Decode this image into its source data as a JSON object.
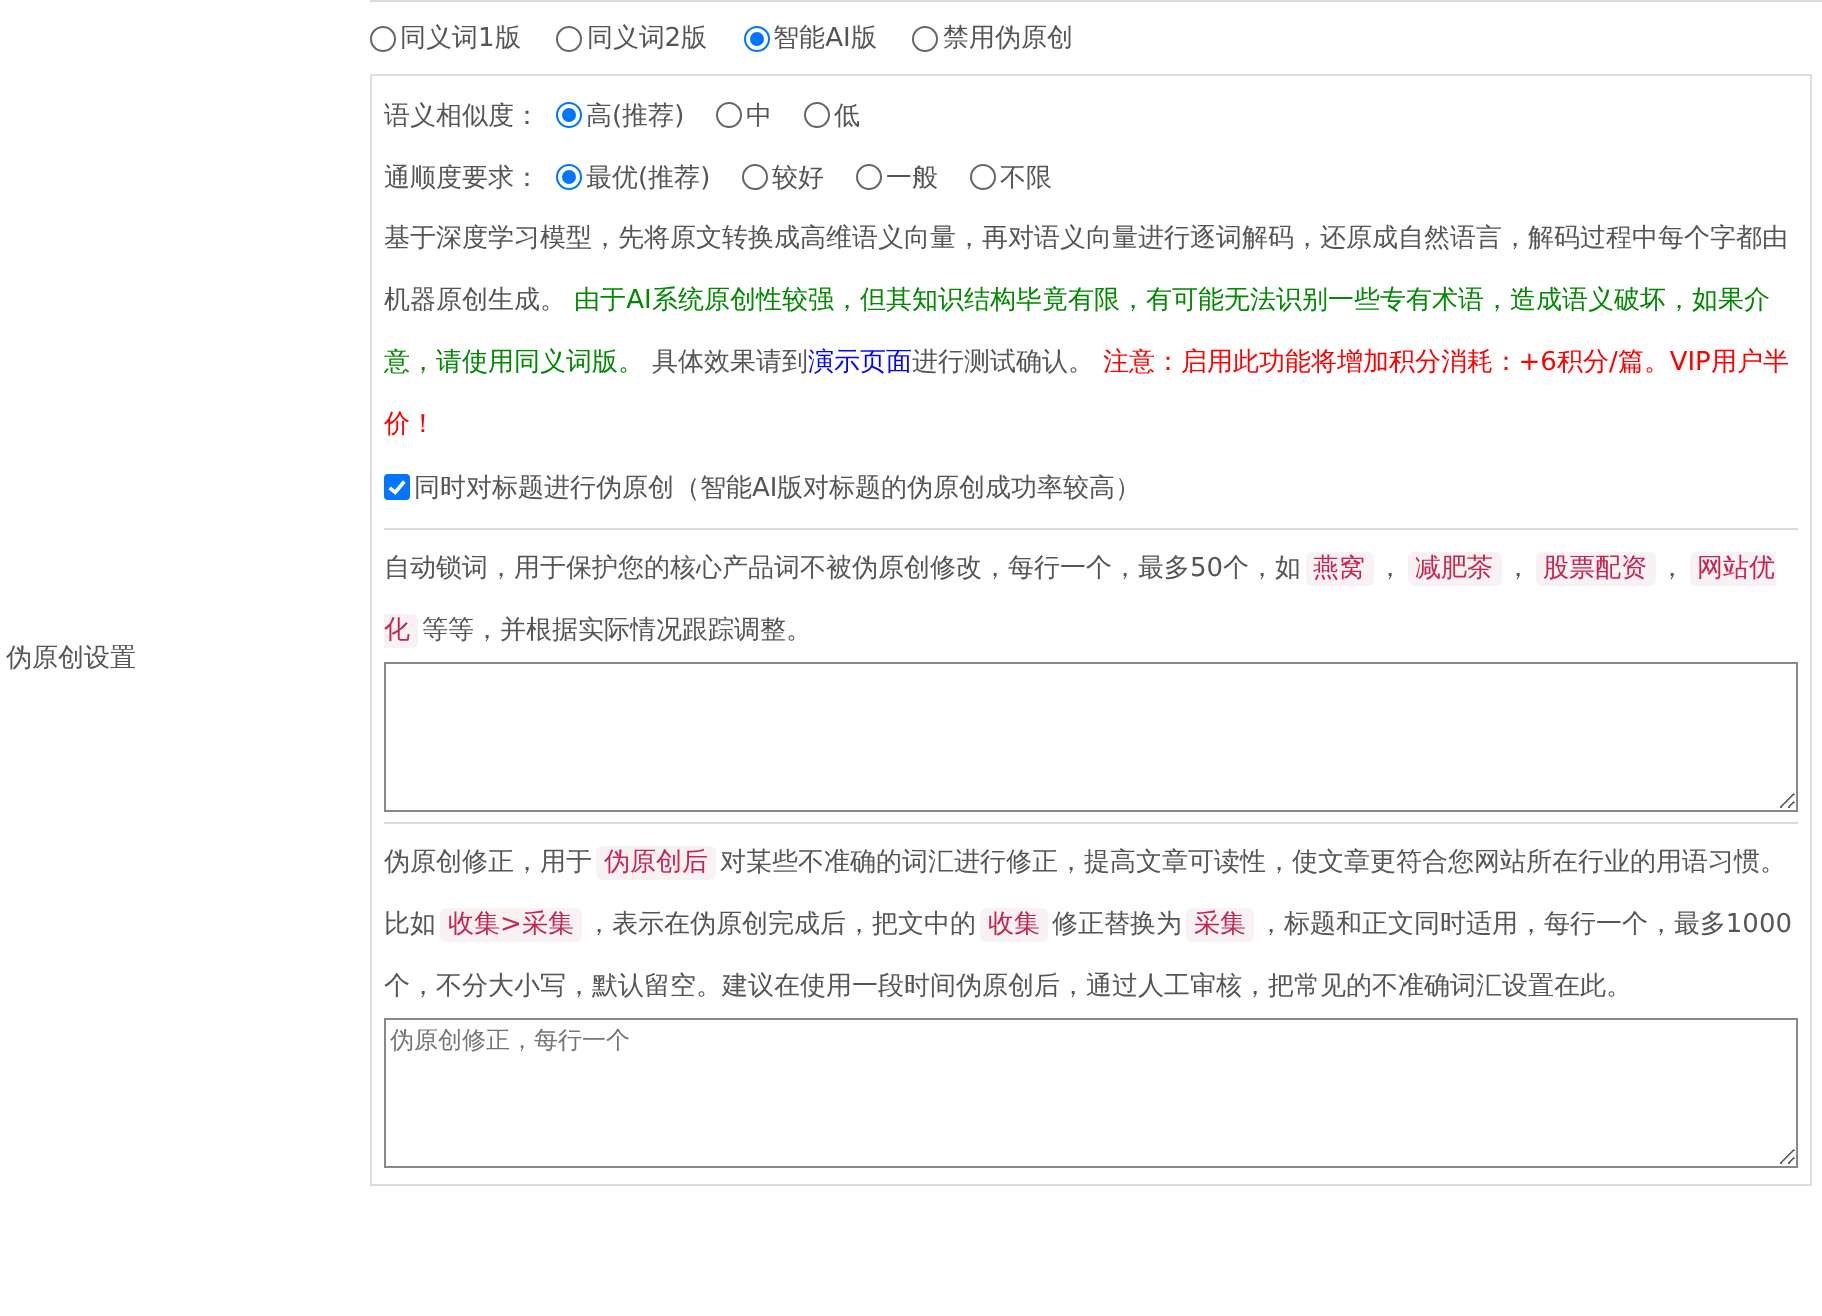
{
  "section_label": "伪原创设置",
  "modes": [
    {
      "label": "同义词1版",
      "selected": false
    },
    {
      "label": "同义词2版",
      "selected": false
    },
    {
      "label": "智能AI版",
      "selected": true
    },
    {
      "label": "禁用伪原创",
      "selected": false
    }
  ],
  "similarity": {
    "label": "语义相似度：",
    "options": [
      {
        "label": "高(推荐)",
        "selected": true
      },
      {
        "label": "中",
        "selected": false
      },
      {
        "label": "低",
        "selected": false
      }
    ]
  },
  "fluency": {
    "label": "通顺度要求：",
    "options": [
      {
        "label": "最优(推荐)",
        "selected": true
      },
      {
        "label": "较好",
        "selected": false
      },
      {
        "label": "一般",
        "selected": false
      },
      {
        "label": "不限",
        "selected": false
      }
    ]
  },
  "description": [
    {
      "kind": "plain",
      "text": "基于深度学习模型，先将原文转换成高维语义向量，再对语义向量进行逐词解码，还原成自然语言，解码过程中每个字都由机器原创生成。 "
    },
    {
      "kind": "green",
      "text": "由于AI系统原创性较强，但其知识结构毕竟有限，有可能无法识别一些专有术语，造成语义破坏，如果介意，请使用同义词版。"
    },
    {
      "kind": "plain",
      "text": " 具体效果请到"
    },
    {
      "kind": "link",
      "text": "演示页面"
    },
    {
      "kind": "plain",
      "text": "进行测试确认。 "
    },
    {
      "kind": "red",
      "text": "注意：启用此功能将增加积分消耗：+6积分/篇。VIP用户半价！"
    }
  ],
  "title_option": {
    "label": "同时对标题进行伪原创（智能AI版对标题的伪原创成功率较高）",
    "checked": true
  },
  "lock_words": {
    "help": [
      {
        "kind": "plain",
        "text": "自动锁词，用于保护您的核心产品词不被伪原创修改，每行一个，最多50个，如"
      },
      {
        "kind": "code",
        "text": "燕窝"
      },
      {
        "kind": "plain",
        "text": "，"
      },
      {
        "kind": "code",
        "text": "减肥茶"
      },
      {
        "kind": "plain",
        "text": "，"
      },
      {
        "kind": "code",
        "text": "股票配资"
      },
      {
        "kind": "plain",
        "text": "，"
      },
      {
        "kind": "code",
        "text": "网站优化"
      },
      {
        "kind": "plain",
        "text": "等等，并根据实际情况跟踪调整。"
      }
    ]
  },
  "corrections": {
    "help": [
      {
        "kind": "plain",
        "text": "伪原创修正，用于"
      },
      {
        "kind": "code",
        "text": "伪原创后"
      },
      {
        "kind": "plain",
        "text": "对某些不准确的词汇进行修正，提高文章可读性，使文章更符合您网站所在行业的用语习惯。比如"
      },
      {
        "kind": "code",
        "text": "收集>采集"
      },
      {
        "kind": "plain",
        "text": "，表示在伪原创完成后，把文中的"
      },
      {
        "kind": "code",
        "text": "收集"
      },
      {
        "kind": "plain",
        "text": "修正替换为"
      },
      {
        "kind": "code",
        "text": "采集"
      },
      {
        "kind": "plain",
        "text": "，标题和正文同时适用，每行一个，最多1000个，不分大小写，默认留空。建议在使用一段时间伪原创后，通过人工审核，把常见的不准确词汇设置在此。"
      }
    ],
    "placeholder": "伪原创修正，每行一个"
  }
}
